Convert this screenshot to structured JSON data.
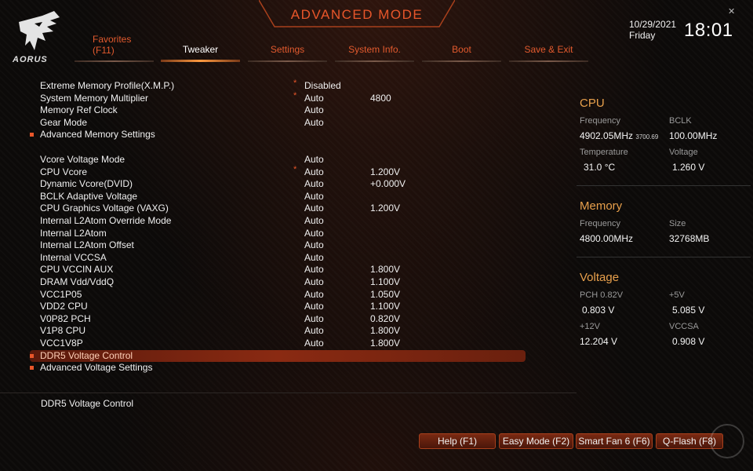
{
  "header": {
    "brand": "AORUS",
    "title": "ADVANCED MODE",
    "date": "10/29/2021",
    "day": "Friday",
    "time": "18:01"
  },
  "tabs": [
    {
      "label": "Favorites",
      "sub": "(F11)"
    },
    {
      "label": "Tweaker"
    },
    {
      "label": "Settings"
    },
    {
      "label": "System Info."
    },
    {
      "label": "Boot"
    },
    {
      "label": "Save & Exit"
    }
  ],
  "settings": [
    {
      "label": "Extreme Memory Profile(X.M.P.)",
      "star": "*",
      "value": "Disabled",
      "value2": ""
    },
    {
      "label": "System Memory Multiplier",
      "star": "*",
      "value": "Auto",
      "value2": "4800"
    },
    {
      "label": "Memory Ref Clock",
      "star": "",
      "value": "Auto",
      "value2": ""
    },
    {
      "label": "Gear Mode",
      "star": "",
      "value": "Auto",
      "value2": ""
    },
    {
      "label": "Advanced Memory Settings",
      "bullet": true,
      "value": "",
      "value2": ""
    },
    {
      "label": "Vcore Voltage Mode",
      "star": "",
      "value": "Auto",
      "value2": ""
    },
    {
      "label": "CPU Vcore",
      "star": "*",
      "value": "Auto",
      "value2": "1.200V"
    },
    {
      "label": "Dynamic Vcore(DVID)",
      "star": "",
      "value": "Auto",
      "value2": "+0.000V"
    },
    {
      "label": "BCLK Adaptive Voltage",
      "star": "",
      "value": "Auto",
      "value2": ""
    },
    {
      "label": "CPU Graphics Voltage (VAXG)",
      "star": "",
      "value": "Auto",
      "value2": "1.200V"
    },
    {
      "label": "Internal L2Atom Override Mode",
      "star": "",
      "value": "Auto",
      "value2": ""
    },
    {
      "label": "Internal L2Atom",
      "star": "",
      "value": "Auto",
      "value2": ""
    },
    {
      "label": "Internal L2Atom Offset",
      "star": "",
      "value": "Auto",
      "value2": ""
    },
    {
      "label": "Internal VCCSA",
      "star": "",
      "value": "Auto",
      "value2": ""
    },
    {
      "label": "CPU VCCIN AUX",
      "star": "",
      "value": "Auto",
      "value2": "1.800V"
    },
    {
      "label": "DRAM Vdd/VddQ",
      "star": "",
      "value": "Auto",
      "value2": "1.100V"
    },
    {
      "label": "VCC1P05",
      "star": "",
      "value": "Auto",
      "value2": "1.050V"
    },
    {
      "label": "VDD2 CPU",
      "star": "",
      "value": "Auto",
      "value2": "1.100V"
    },
    {
      "label": "V0P82 PCH",
      "star": "",
      "value": "Auto",
      "value2": "0.820V"
    },
    {
      "label": "V1P8 CPU",
      "star": "",
      "value": "Auto",
      "value2": "1.800V"
    },
    {
      "label": "VCC1V8P",
      "star": "",
      "value": "Auto",
      "value2": "1.800V"
    },
    {
      "label": "DDR5 Voltage Control",
      "bullet": true,
      "selected": true,
      "value": "",
      "value2": ""
    },
    {
      "label": "Advanced Voltage Settings",
      "bullet": true,
      "value": "",
      "value2": ""
    }
  ],
  "description": "DDR5 Voltage Control",
  "cpu": {
    "title": "CPU",
    "frequency_label": "Frequency",
    "frequency": "4902.05MHz",
    "frequency_small": "3700.69",
    "bclk_label": "BCLK",
    "bclk": "100.00MHz",
    "temperature_label": "Temperature",
    "temperature": "31.0 °C",
    "voltage_label": "Voltage",
    "voltage": "1.260 V"
  },
  "memory": {
    "title": "Memory",
    "frequency_label": "Frequency",
    "frequency": "4800.00MHz",
    "size_label": "Size",
    "size": "32768MB"
  },
  "voltage": {
    "title": "Voltage",
    "pch_label": "PCH 0.82V",
    "pch": "0.803 V",
    "p5v_label": "+5V",
    "p5v": "5.085 V",
    "p12v_label": "+12V",
    "p12v": "12.204 V",
    "vccsa_label": "VCCSA",
    "vccsa": "0.908 V"
  },
  "buttons": {
    "help": "Help (F1)",
    "easy": "Easy Mode (F2)",
    "fan": "Smart Fan 6 (F6)",
    "qflash": "Q-Flash (F8)"
  },
  "colors": {
    "accent": "#e8562a",
    "panel_title": "#e8a04c",
    "selected_row": "#8a2a12"
  }
}
